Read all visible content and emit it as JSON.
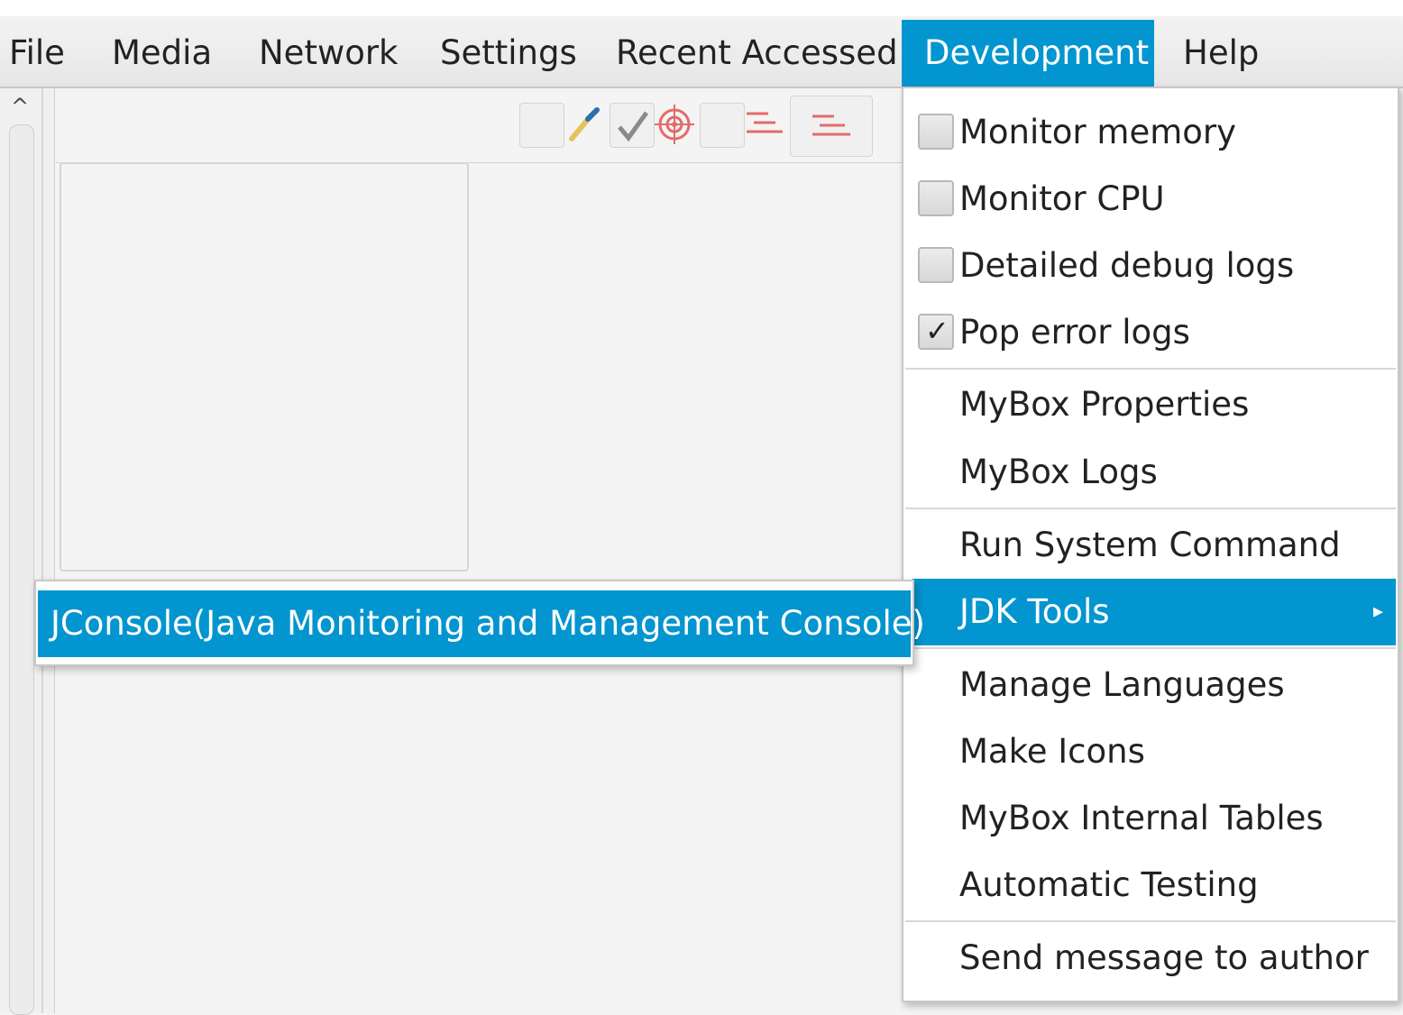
{
  "menubar": {
    "items": [
      {
        "label": "File"
      },
      {
        "label": "Media"
      },
      {
        "label": "Network"
      },
      {
        "label": "Settings"
      },
      {
        "label": "Recent Accessed"
      },
      {
        "label": "Development",
        "active": true
      },
      {
        "label": "Help"
      }
    ]
  },
  "toolbar": {
    "icons": [
      "blank-square-icon",
      "eyedropper-icon",
      "checkmark-icon",
      "target-icon",
      "blank-square-icon",
      "lines-icon",
      "lines-icon"
    ]
  },
  "dropdown": {
    "items": [
      {
        "label": "Monitor memory",
        "checkbox": true,
        "checked": false
      },
      {
        "label": "Monitor CPU",
        "checkbox": true,
        "checked": false
      },
      {
        "label": "Detailed debug logs",
        "checkbox": true,
        "checked": false
      },
      {
        "label": "Pop error logs",
        "checkbox": true,
        "checked": true
      },
      {
        "label": "MyBox Properties"
      },
      {
        "label": "MyBox Logs"
      },
      {
        "label": "Run System Command"
      },
      {
        "label": "JDK Tools",
        "submenu": true,
        "active": true
      },
      {
        "label": "Manage Languages"
      },
      {
        "label": "Make Icons"
      },
      {
        "label": "MyBox Internal Tables"
      },
      {
        "label": "Automatic Testing"
      },
      {
        "label": "Send message to author"
      }
    ],
    "check_glyph": "✓",
    "submenu_arrow": "▸"
  },
  "submenu": {
    "items": [
      {
        "label": "JConsole(Java Monitoring and Management Console)"
      }
    ]
  },
  "scroll": {
    "up_glyph": "^"
  },
  "colors": {
    "accent": "#0395cf",
    "menubar": "#e9e9e9",
    "background": "#f4f4f4"
  }
}
